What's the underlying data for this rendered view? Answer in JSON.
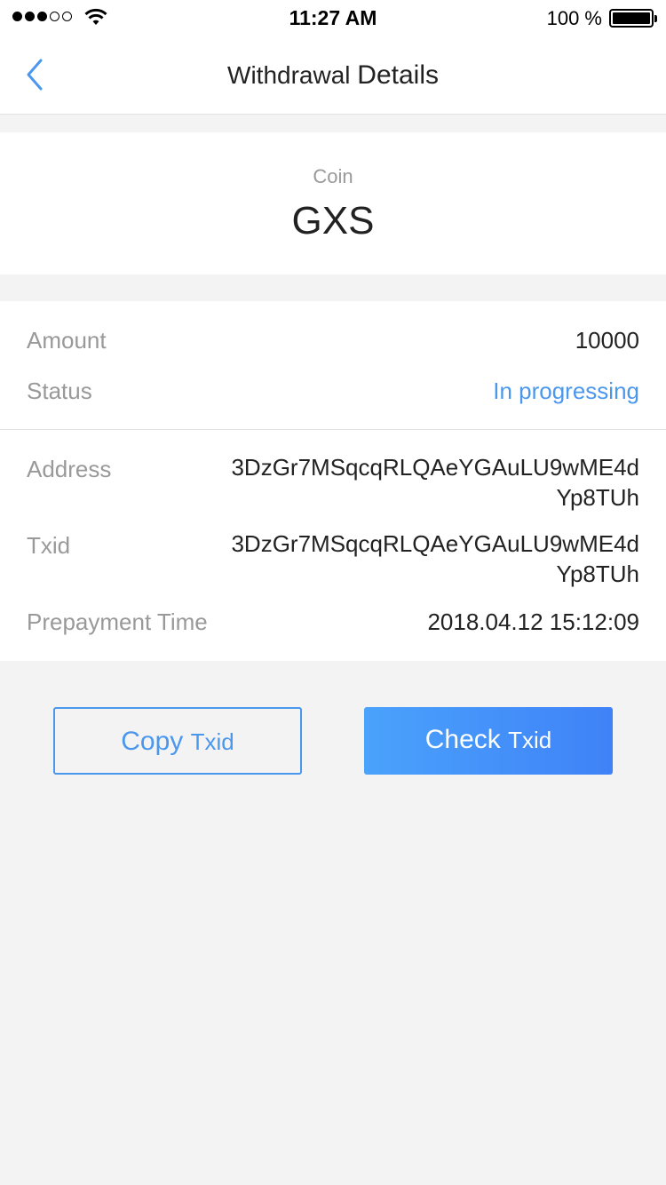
{
  "status_bar": {
    "time": "11:27 AM",
    "battery_text": "100 %",
    "signal_icon": "signal-dots-icon",
    "wifi_icon": "wifi-icon",
    "battery_icon": "battery-icon"
  },
  "nav": {
    "title_part1": "Withdrawal",
    "title_part2": "Details",
    "back_icon": "chevron-left-icon",
    "accent_color": "#4a97ee"
  },
  "coin": {
    "label": "Coin",
    "value": "GXS"
  },
  "details": {
    "amount_label": "Amount",
    "amount_value": "10000",
    "status_label": "Status",
    "status_value": "In progressing",
    "address_label": "Address",
    "address_value": "3DzGr7MSqcqRLQAeYGAuLU9wME4dYp8TUh",
    "txid_label": "Txid",
    "txid_value": "3DzGr7MSqcqRLQAeYGAuLU9wME4dYp8TUh",
    "prepayment_label": "Prepayment Time",
    "prepayment_value": "2018.04.12 15:12:09"
  },
  "buttons": {
    "copy_main": "Copy",
    "copy_small": "Txid",
    "check_main": "Check",
    "check_small": "Txid"
  }
}
